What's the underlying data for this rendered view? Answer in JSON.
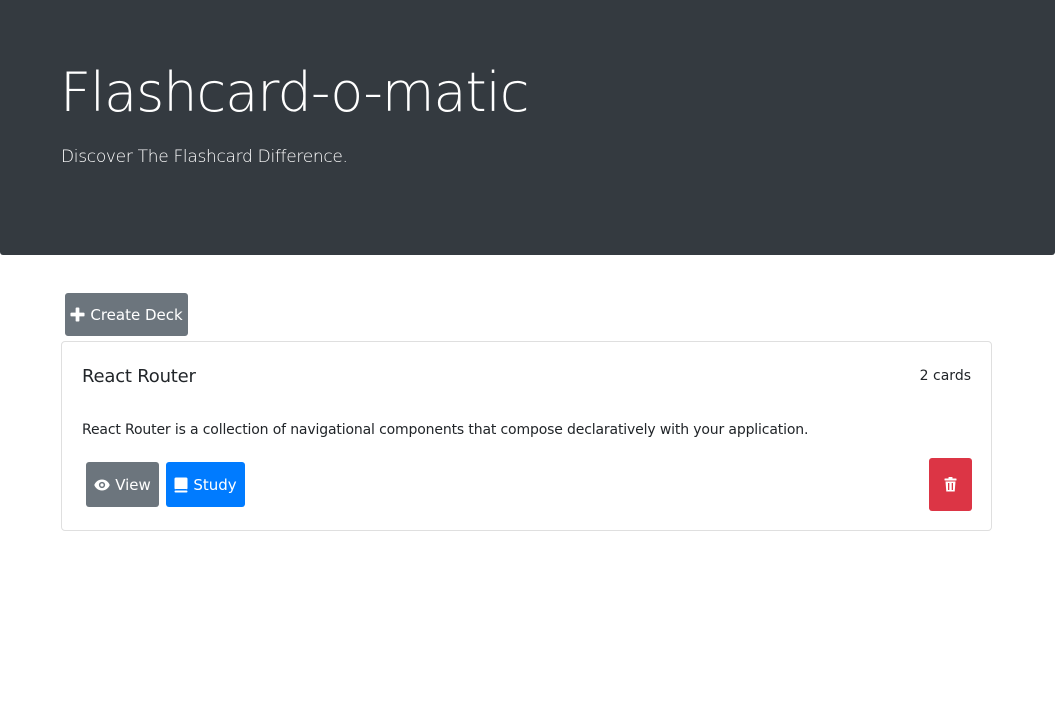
{
  "header": {
    "title": "Flashcard-o-matic",
    "subtitle": "Discover The Flashcard Difference."
  },
  "toolbar": {
    "create_deck_label": "Create Deck",
    "create_icon": "plus-icon"
  },
  "decks": [
    {
      "name": "React Router",
      "card_count": "2 cards",
      "description": "React Router is a collection of navigational components that compose declaratively with your application.",
      "view_label": "View",
      "view_icon": "eye-icon",
      "study_label": "Study",
      "study_icon": "book-icon",
      "delete_icon": "trash-icon"
    }
  ],
  "colors": {
    "header_bg": "#343a40",
    "secondary": "#6c757d",
    "primary": "#007bff",
    "danger": "#dc3545",
    "card_border": "#dfdfdf"
  }
}
